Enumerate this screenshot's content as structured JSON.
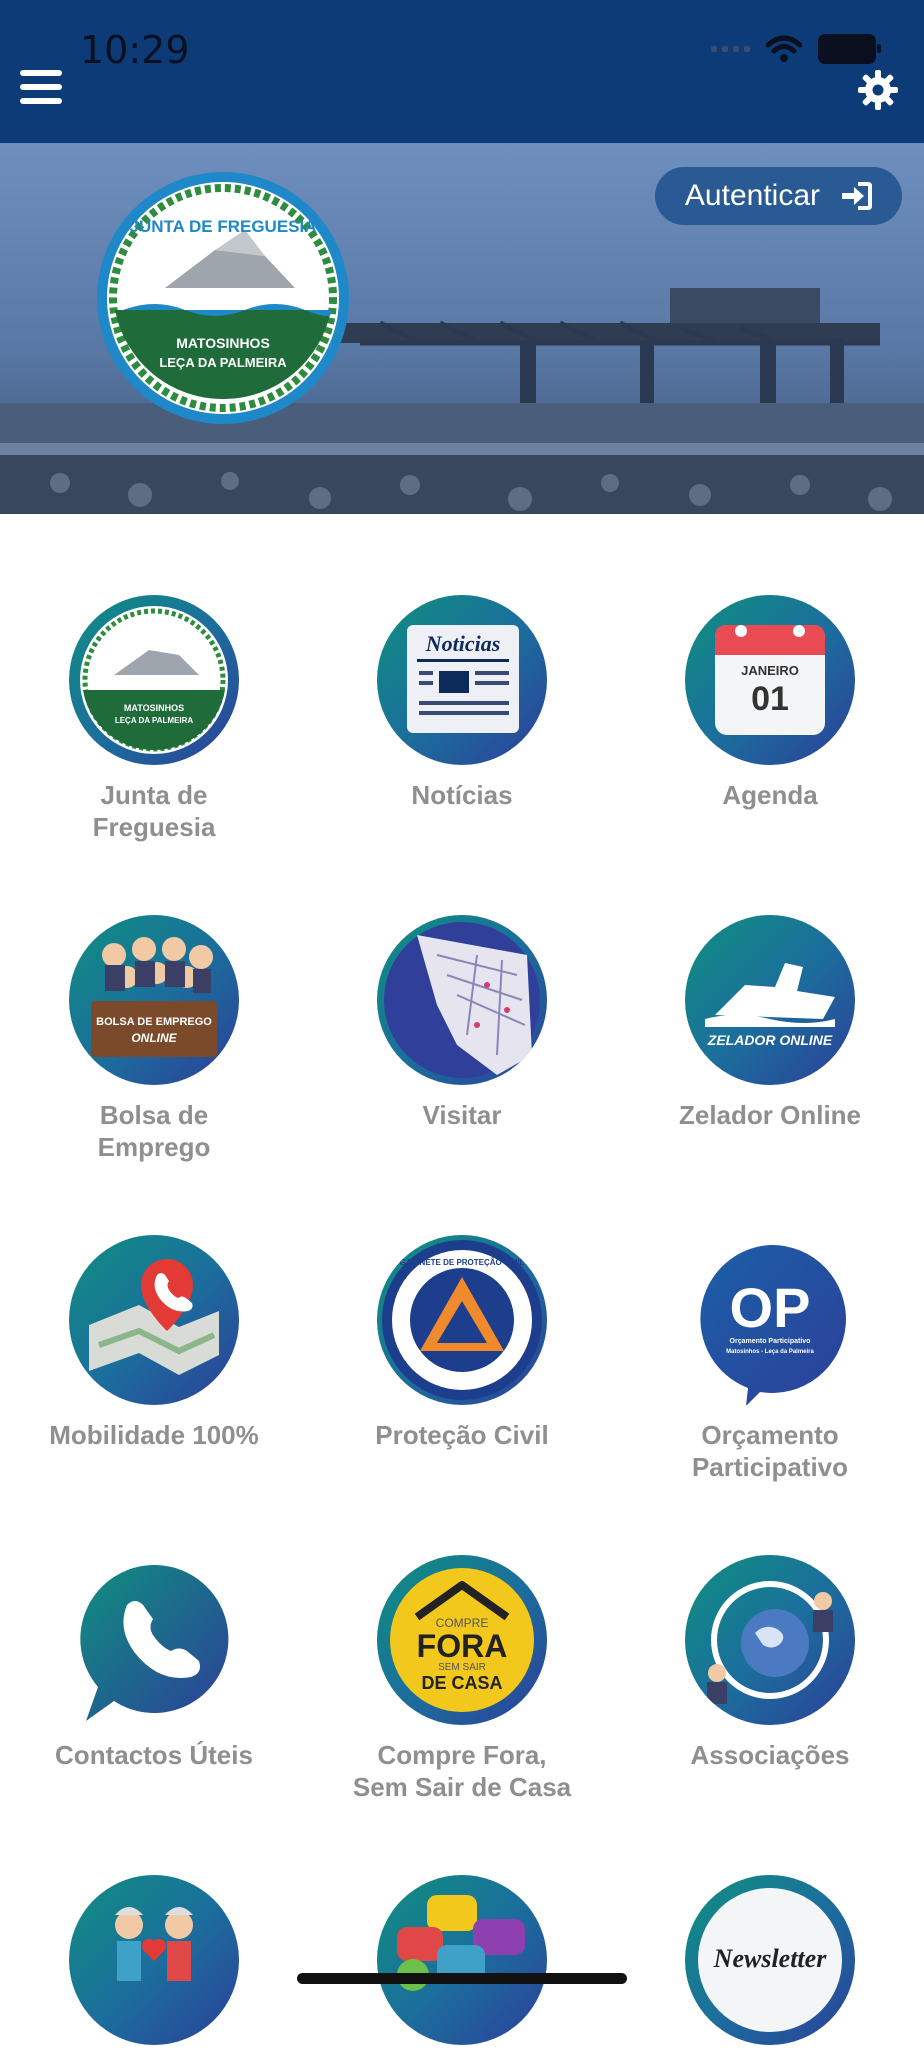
{
  "status_bar": {
    "time": "10:29"
  },
  "header": {
    "menu_icon": "hamburger-icon",
    "settings_icon": "gear-icon"
  },
  "hero": {
    "logo_top_text": "JUNTA DE FREGUESIA",
    "logo_bottom_line1": "MATOSINHOS",
    "logo_bottom_line2": "LEÇA DA PALMEIRA",
    "auth_label": "Autenticar",
    "auth_icon": "sign-in-icon"
  },
  "menu": {
    "items": [
      {
        "label_line1": "Junta de",
        "label_line2": "Freguesia",
        "icon": "junta-logo-icon"
      },
      {
        "label_line1": "Notícias",
        "label_line2": "",
        "icon": "newspaper-icon",
        "icon_text": "Noticias"
      },
      {
        "label_line1": "Agenda",
        "label_line2": "",
        "icon": "calendar-icon",
        "icon_month": "JANEIRO",
        "icon_day": "01"
      },
      {
        "label_line1": "Bolsa de",
        "label_line2": "Emprego",
        "icon": "job-board-icon",
        "icon_text1": "BOLSA DE EMPREGO",
        "icon_text2": "ONLINE"
      },
      {
        "label_line1": "Visitar",
        "label_line2": "",
        "icon": "map-icon"
      },
      {
        "label_line1": "Zelador Online",
        "label_line2": "",
        "icon": "zelador-icon",
        "icon_text": "ZELADOR ONLINE"
      },
      {
        "label_line1": "Mobilidade 100%",
        "label_line2": "",
        "icon": "map-phone-icon"
      },
      {
        "label_line1": "Proteção Civil",
        "label_line2": "",
        "icon": "civil-protection-icon",
        "icon_text": "GABINETE DE PROTEÇÃO CIVIL"
      },
      {
        "label_line1": "Orçamento",
        "label_line2": "Participativo",
        "icon": "op-icon",
        "icon_text": "OP",
        "icon_sub1": "Orçamento Participativo",
        "icon_sub2": "Matosinhos - Leça da Palmeira"
      },
      {
        "label_line1": "Contactos Úteis",
        "label_line2": "",
        "icon": "phone-icon"
      },
      {
        "label_line1": "Compre Fora,",
        "label_line2": "Sem Sair de Casa",
        "icon": "shop-home-icon",
        "icon_t1": "COMPRE",
        "icon_t2": "FORA",
        "icon_t3": "SEM SAIR",
        "icon_t4": "DE CASA"
      },
      {
        "label_line1": "Associações",
        "label_line2": "",
        "icon": "associations-icon"
      },
      {
        "label_line1": "",
        "label_line2": "",
        "icon": "seniors-icon"
      },
      {
        "label_line1": "",
        "label_line2": "",
        "icon": "speech-bubbles-icon"
      },
      {
        "label_line1": "",
        "label_line2": "",
        "icon": "newsletter-icon",
        "icon_text": "Newsletter"
      }
    ]
  }
}
